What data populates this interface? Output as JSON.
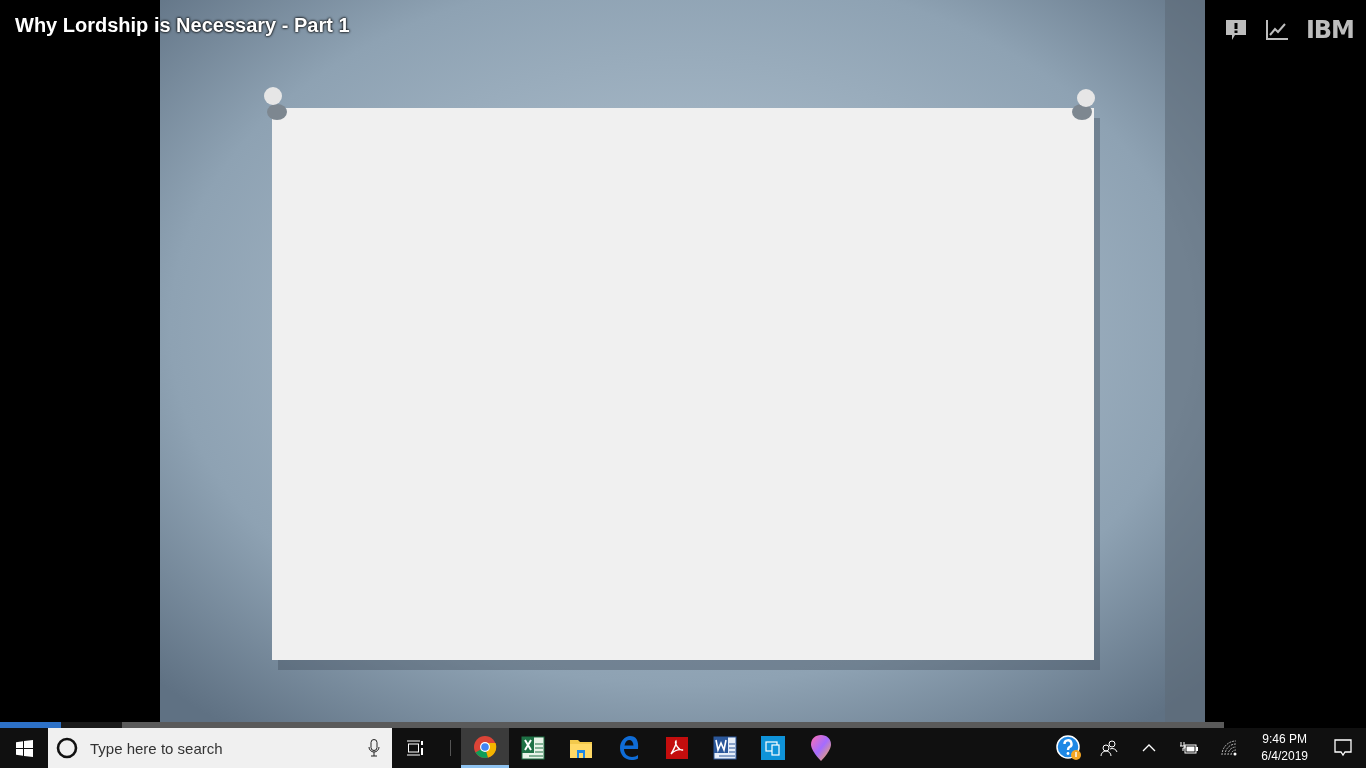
{
  "video": {
    "title": "Why Lordship is Necessary - Part 1",
    "logo": "IBM",
    "progress": {
      "level": 0.05,
      "buffer": {
        "level": 0.1
      }
    }
  },
  "taskbar": {
    "search": {
      "placeholder": "Type here to search"
    },
    "apps": [
      {
        "kind": "chrome",
        "selected": true
      },
      {
        "kind": "excel",
        "selected": false
      },
      {
        "kind": "folder",
        "selected": false
      },
      {
        "kind": "edge",
        "selected": false
      },
      {
        "kind": "acrobat",
        "selected": false
      },
      {
        "kind": "word",
        "selected": false
      },
      {
        "kind": "phone-link",
        "selected": false
      },
      {
        "kind": "maps",
        "selected": false
      }
    ],
    "clock": {
      "time": "9:46 PM",
      "date": "6/4/2019"
    }
  }
}
